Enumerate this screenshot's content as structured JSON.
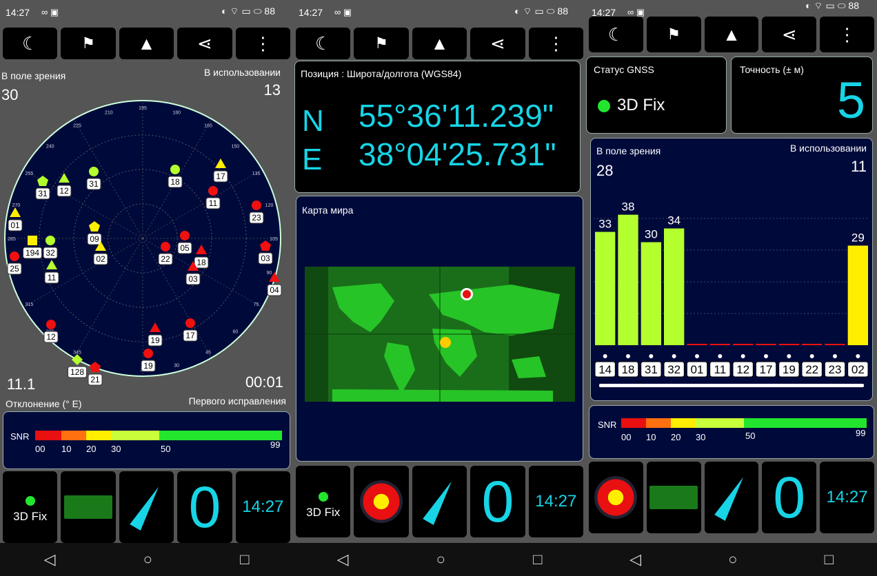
{
  "status": {
    "time": "14:27",
    "battery": "88"
  },
  "toolbar_icons": [
    "moon-icon",
    "person-flag-icon",
    "navigation-arrow-icon",
    "share-icon",
    "more-vert-icon"
  ],
  "p1": {
    "in_view_label": "В поле зрения",
    "in_view": "30",
    "in_use_label": "В использовании",
    "in_use": "13",
    "declination": "11.1",
    "declination_label": "Отклонение (° E)",
    "ttff": "00:01",
    "ttff_label": "Первого исправления",
    "compass_ticks": [
      "15",
      "30",
      "45",
      "60",
      "75",
      "90",
      "105",
      "120",
      "135",
      "150",
      "165",
      "180",
      "195",
      "210",
      "225",
      "240",
      "255",
      "270",
      "285",
      "300",
      "315",
      "330",
      "345"
    ],
    "satellites": [
      {
        "id": "31",
        "x": 62,
        "y": 263,
        "shape": "pentagon",
        "color": "#b4ff2e"
      },
      {
        "id": "12",
        "x": 93,
        "y": 259,
        "shape": "triangle",
        "color": "#b4ff2e"
      },
      {
        "id": "31",
        "x": 136,
        "y": 249,
        "shape": "circle",
        "color": "#b4ff2e"
      },
      {
        "id": "18",
        "x": 254,
        "y": 246,
        "shape": "circle",
        "color": "#b4ff2e"
      },
      {
        "id": "17",
        "x": 320,
        "y": 238,
        "shape": "triangle",
        "color": "#ffee00"
      },
      {
        "id": "11",
        "x": 309,
        "y": 277,
        "shape": "circle",
        "color": "#f01010"
      },
      {
        "id": "23",
        "x": 372,
        "y": 298,
        "shape": "circle",
        "color": "#f01010"
      },
      {
        "id": "01",
        "x": 22,
        "y": 309,
        "shape": "triangle",
        "color": "#ffee00"
      },
      {
        "id": "09",
        "x": 137,
        "y": 329,
        "shape": "pentagon",
        "color": "#ffee00"
      },
      {
        "id": "194",
        "x": 47,
        "y": 349,
        "shape": "square",
        "color": "#ffee00"
      },
      {
        "id": "32",
        "x": 73,
        "y": 349,
        "shape": "circle",
        "color": "#b4ff2e"
      },
      {
        "id": "02",
        "x": 146,
        "y": 358,
        "shape": "triangle",
        "color": "#ffee00"
      },
      {
        "id": "25",
        "x": 21,
        "y": 372,
        "shape": "circle",
        "color": "#f01010"
      },
      {
        "id": "11",
        "x": 75,
        "y": 385,
        "shape": "triangle",
        "color": "#b4ff2e"
      },
      {
        "id": "22",
        "x": 240,
        "y": 358,
        "shape": "circle",
        "color": "#f01010"
      },
      {
        "id": "05",
        "x": 268,
        "y": 342,
        "shape": "circle",
        "color": "#f01010"
      },
      {
        "id": "18",
        "x": 292,
        "y": 363,
        "shape": "triangle",
        "color": "#f01010"
      },
      {
        "id": "03",
        "x": 385,
        "y": 357,
        "shape": "pentagon",
        "color": "#f01010"
      },
      {
        "id": "03",
        "x": 280,
        "y": 387,
        "shape": "triangle",
        "color": "#f01010"
      },
      {
        "id": "04",
        "x": 398,
        "y": 403,
        "shape": "triangle",
        "color": "#f01010"
      },
      {
        "id": "12",
        "x": 74,
        "y": 471,
        "shape": "circle",
        "color": "#f01010"
      },
      {
        "id": "19",
        "x": 225,
        "y": 476,
        "shape": "triangle",
        "color": "#f01010"
      },
      {
        "id": "17",
        "x": 276,
        "y": 469,
        "shape": "circle",
        "color": "#f01010"
      },
      {
        "id": "19",
        "x": 215,
        "y": 513,
        "shape": "circle",
        "color": "#f01010"
      },
      {
        "id": "128",
        "x": 112,
        "y": 522,
        "shape": "diamond",
        "color": "#b4ff2e"
      },
      {
        "id": "21",
        "x": 138,
        "y": 533,
        "shape": "pentagon",
        "color": "#f01010"
      }
    ]
  },
  "snr": {
    "label": "SNR",
    "ticks": [
      "00",
      "10",
      "20",
      "30",
      "50",
      "99"
    ]
  },
  "p2": {
    "position_label": "Позиция : Широта/долгота (WGS84)",
    "lat_hemi": "N",
    "lat": "55°36'11.239\"",
    "lon_hemi": "E",
    "lon": "38°04'25.731\"",
    "map_label": "Карта мира"
  },
  "p3": {
    "gnss_label": "Статус GNSS",
    "gnss_status": "3D Fix",
    "accuracy_label": "Точность (± м)",
    "accuracy": "5",
    "in_view_label": "В поле зрения",
    "in_view": "28",
    "in_use_label": "В использовании",
    "in_use": "11"
  },
  "chart_data": {
    "type": "bar",
    "categories": [
      "14",
      "18",
      "31",
      "32",
      "01",
      "11",
      "12",
      "17",
      "19",
      "22",
      "23",
      "02"
    ],
    "values": [
      33,
      38,
      30,
      34,
      0,
      0,
      0,
      0,
      0,
      0,
      0,
      29
    ],
    "ylim": [
      0,
      60
    ],
    "bar_colors": [
      "#b4ff2e",
      "#b4ff2e",
      "#b4ff2e",
      "#b4ff2e",
      "#f01010",
      "#f01010",
      "#f01010",
      "#f01010",
      "#f01010",
      "#f01010",
      "#f01010",
      "#ffee00"
    ]
  },
  "dock": {
    "fix": "3D Fix",
    "zero": "0",
    "time": "14:27"
  },
  "colors": {
    "cyan": "#17d4e6",
    "green": "#22e62e",
    "navy": "#000a3a"
  }
}
